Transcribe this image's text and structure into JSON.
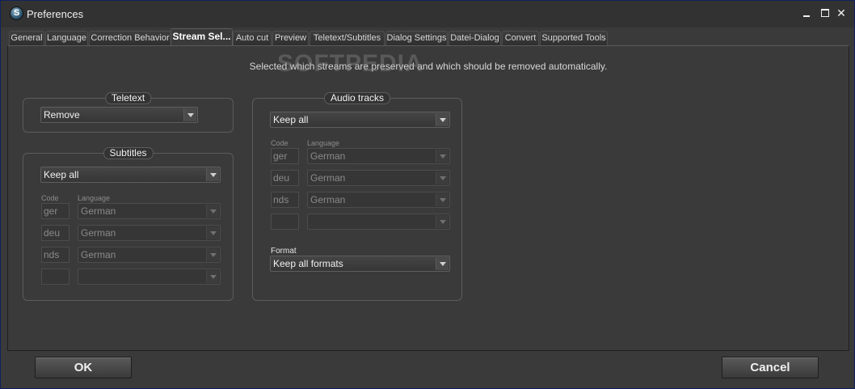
{
  "window": {
    "title": "Preferences"
  },
  "tabs": [
    {
      "label": "General"
    },
    {
      "label": "Language"
    },
    {
      "label": "Correction Behavior"
    },
    {
      "label": "Stream Sel..."
    },
    {
      "label": "Auto cut"
    },
    {
      "label": "Preview"
    },
    {
      "label": "Teletext/Subtitles"
    },
    {
      "label": "Dialog Settings"
    },
    {
      "label": "Datei-Dialog"
    },
    {
      "label": "Convert"
    },
    {
      "label": "Supported Tools"
    }
  ],
  "active_tab": "Stream Sel...",
  "description": "Selected which streams are preserved and which should be removed automatically.",
  "watermark": "SOFTPEDIA",
  "teletext": {
    "title": "Teletext",
    "mode": "Remove"
  },
  "subtitles": {
    "title": "Subtitles",
    "mode": "Keep all",
    "code_header": "Code",
    "language_header": "Language",
    "rows": [
      {
        "code": "ger",
        "language": "German"
      },
      {
        "code": "deu",
        "language": "German"
      },
      {
        "code": "nds",
        "language": "German"
      },
      {
        "code": "",
        "language": ""
      }
    ]
  },
  "audio": {
    "title": "Audio tracks",
    "mode": "Keep all",
    "code_header": "Code",
    "language_header": "Language",
    "rows": [
      {
        "code": "ger",
        "language": "German"
      },
      {
        "code": "deu",
        "language": "German"
      },
      {
        "code": "nds",
        "language": "German"
      },
      {
        "code": "",
        "language": ""
      }
    ],
    "format_label": "Format",
    "format_value": "Keep all formats"
  },
  "buttons": {
    "ok": "OK",
    "cancel": "Cancel"
  }
}
